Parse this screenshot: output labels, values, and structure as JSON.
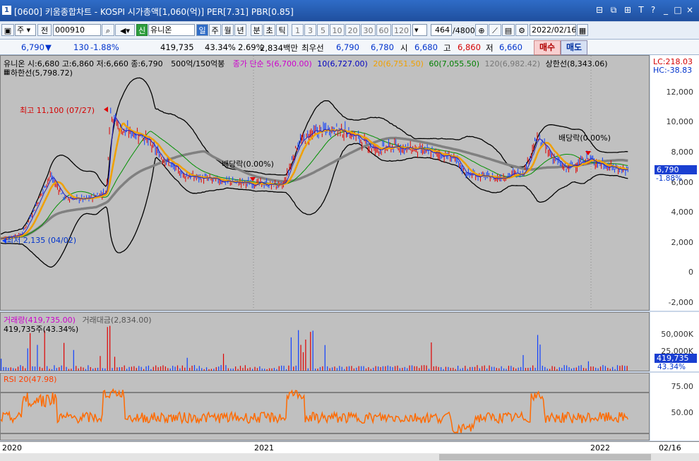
{
  "window": {
    "title": "[0600] 키움종합차트 - KOSPI 시가총액[1,060(억)] PER[7.31] PBR[0.85]",
    "icon_label": "1",
    "controls": [
      "⊟",
      "⧉",
      "⊞",
      "T",
      "?",
      "_",
      "□",
      "×"
    ]
  },
  "toolbar": {
    "period_select": "주",
    "prev_label": "전",
    "code_value": "000910",
    "badge": "신",
    "stock_name": "유니온",
    "periods": [
      "일",
      "주",
      "월",
      "년",
      "분",
      "초",
      "틱"
    ],
    "intervals": [
      "1",
      "3",
      "5",
      "10",
      "20",
      "30",
      "60",
      "120"
    ],
    "count_value": "464",
    "count_total": "/4800",
    "date_value": "2022/02/16"
  },
  "quote": {
    "price": "6,790",
    "change": "130",
    "change_pct": "-1.88%",
    "volume": "419,735",
    "volume_ratio": "43.34%",
    "turnover": "2.69%",
    "amount": "2,834백만",
    "best_label": "최우선",
    "best_ask": "6,790",
    "best_bid": "6,780",
    "open_label": "시",
    "open": "6,680",
    "high_label": "고",
    "high": "6,860",
    "low_label": "저",
    "low": "6,660",
    "buy_label": "매수",
    "sell_label": "매도"
  },
  "main_panel": {
    "legend": {
      "name": "유니온",
      "ohlc": "시:6,680 고:6,860 저:6,660 종:6,790",
      "volume_cond": "500억/150억봉",
      "ma_title": "종가 단순",
      "ma5": "5(6,700.00)",
      "ma10": "10(6,727.00)",
      "ma20": "20(6,751.50)",
      "ma60": "60(7,055.50)",
      "ma120": "120(6,982.42)",
      "upper_label": "상한선(8,343.06)",
      "lower_label": "하한선(5,798.72)"
    },
    "lc": "LC:218.03",
    "hc": "HC:-38.83",
    "yticks": [
      "12,000",
      "10,000",
      "8,000",
      "6,000",
      "4,000",
      "2,000",
      "0",
      "-2,000"
    ],
    "annotations": {
      "high": "최고 11,100 (07/27)",
      "low": "최저 2,135 (04/02)",
      "dividend1": "배당락(0.00%)",
      "dividend2": "배당락(0.00%)"
    },
    "price_tag": "6,790",
    "pct_tag": "-1.88%"
  },
  "volume_panel": {
    "legend_vol": "거래량(419,735.00)",
    "legend_amt": "거래대금(2,834.00)",
    "sub": "419,735주(43.34%)",
    "yticks": [
      "50,000K",
      "25,000K"
    ],
    "vol_tag": "419,735",
    "pct_tag": "43.34%"
  },
  "rsi_panel": {
    "legend": "RSI 20(47.98)",
    "yticks": [
      "75.00",
      "50.00"
    ]
  },
  "xaxis": {
    "labels": [
      "2020",
      "2021",
      "2022"
    ],
    "right_label": "02/16"
  },
  "colors": {
    "ma5": "#2020c0",
    "ma20": "#f0a000",
    "ma60": "#008000",
    "ma120": "#808080",
    "rsi": "#ff6a00",
    "up": "#e00000",
    "down": "#1040ff"
  }
}
